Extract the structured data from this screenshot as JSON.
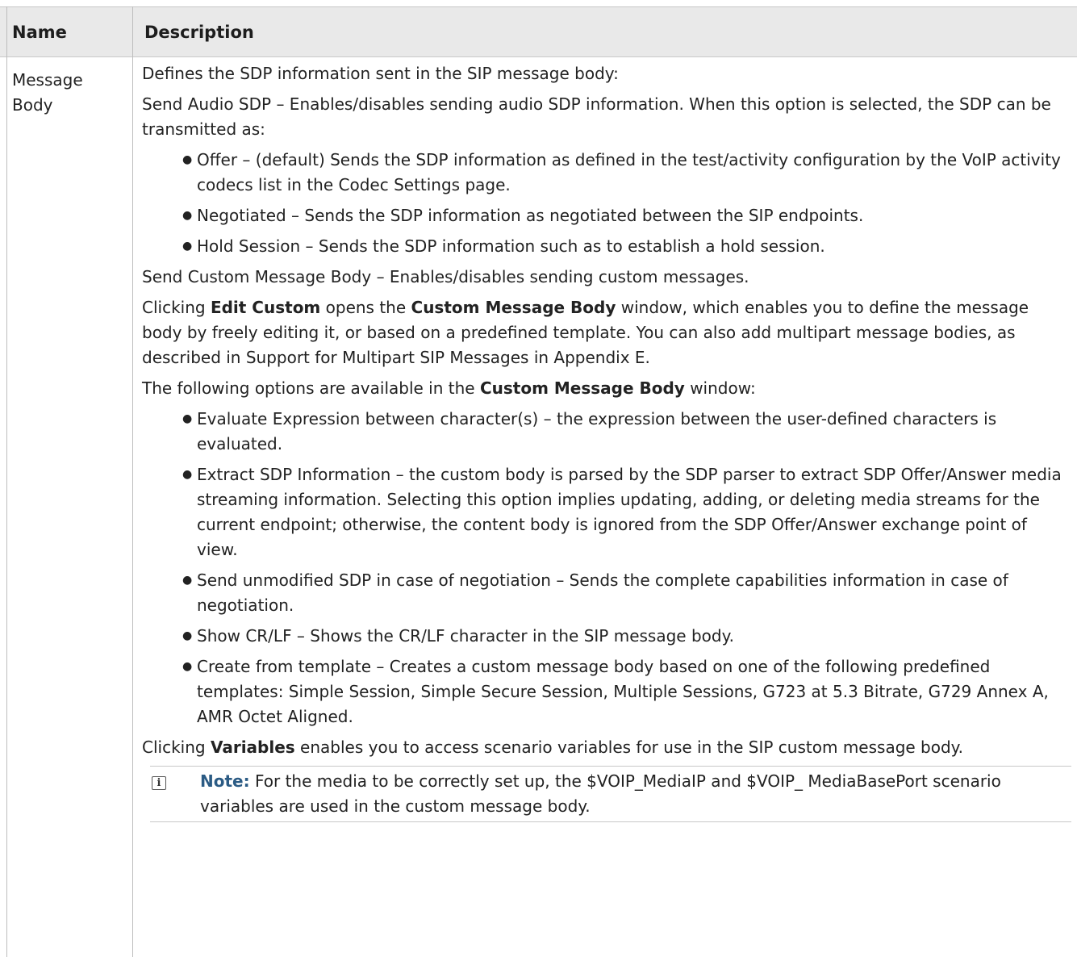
{
  "header": {
    "name": "Name",
    "description": "Description"
  },
  "row": {
    "name_line1": "Message",
    "name_line2": "Body",
    "p1": "Defines the SDP information sent in the SIP message body:",
    "p2": "Send Audio SDP – Enables/disables sending audio SDP information. When this option is selected, the SDP can be transmitted as:",
    "list1": [
      "Offer – (default) Sends the SDP information as defined in the test/activity configuration by the VoIP activity codecs list in the Codec Settings page.",
      "Negotiated – Sends the SDP information as negotiated between the SIP endpoints.",
      "Hold Session – Sends the SDP information such as to establish a hold session."
    ],
    "p3": "Send Custom Message Body – Enables/disables sending custom messages.",
    "p4_a": "Clicking ",
    "p4_b": "Edit Custom",
    "p4_c": " opens the ",
    "p4_d": "Custom Message Body",
    "p4_e": " window, which enables you to define the message body by freely editing it, or based on a predefined template. You can also add multipart message bodies, as described in Support for Multipart SIP Messages in Appendix E.",
    "p5_a": "The following options are available in the ",
    "p5_b": "Custom Message Body",
    "p5_c": " window:",
    "list2": [
      "Evaluate Expression between character(s) – the expression between the user-defined characters is evaluated.",
      "Extract SDP Information – the custom body is parsed by the SDP parser to extract SDP Offer/Answer media streaming information. Selecting this option implies updating, adding, or deleting media streams for the current endpoint; otherwise, the content body is ignored from the SDP Offer/Answer exchange point of view.",
      "Send unmodified SDP in case of negotiation – Sends the complete capabilities information in case of negotiation.",
      "Show CR/LF – Shows the CR/LF character in the SIP message body.",
      "Create from template – Creates a custom message body based on one of the following predefined templates: Simple Session, Simple Secure Session, Multiple Sessions, G723 at 5.3 Bitrate, G729 Annex A, AMR Octet Aligned."
    ],
    "p6_a": "Clicking ",
    "p6_b": "Variables",
    "p6_c": " enables you to access scenario variables for use in the SIP custom message body.",
    "note_label": "Note:",
    "note_text": " For the media to be correctly set up, the $VOIP_MediaIP and $VOIP_ MediaBasePort scenario variables are used in the custom message body."
  },
  "note_icon": "info-icon",
  "colors": {
    "header_bg": "#e9e9e9",
    "note_label": "#2b5b84",
    "border": "#c8c8c8"
  }
}
